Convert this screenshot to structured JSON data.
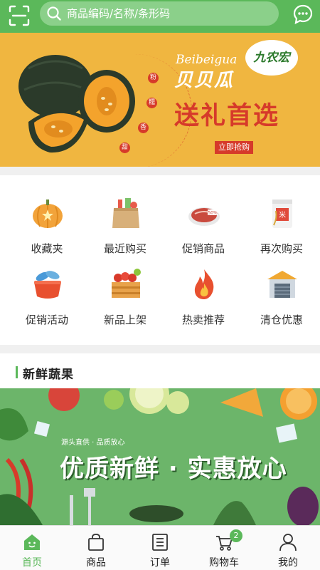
{
  "header": {
    "search_placeholder": "商品编码/名称/条形码",
    "scan_icon": "scan-icon",
    "message_icon": "message-icon"
  },
  "banner": {
    "brand_en": "Beibeigua",
    "brand_cn": "贝贝瓜",
    "title": "送礼首选",
    "button": "立即抢购",
    "logo_text": "九农宏",
    "tags": [
      "粉",
      "糯",
      "香",
      "甜"
    ]
  },
  "grid": {
    "items": [
      {
        "label": "收藏夹",
        "icon": "pumpkin-icon"
      },
      {
        "label": "最近购买",
        "icon": "grocery-bag-icon"
      },
      {
        "label": "促销商品",
        "icon": "meat-tray-icon"
      },
      {
        "label": "再次购买",
        "icon": "rice-bag-icon"
      },
      {
        "label": "促销活动",
        "icon": "fish-basket-icon"
      },
      {
        "label": "新品上架",
        "icon": "fruit-crate-icon"
      },
      {
        "label": "热卖推荐",
        "icon": "fire-icon"
      },
      {
        "label": "清仓优惠",
        "icon": "warehouse-icon"
      }
    ],
    "meat_tag": "50%",
    "rice_tag": "米"
  },
  "section": {
    "title": "新鲜蔬果"
  },
  "promo": {
    "small_text": "源头直供 · 品质放心",
    "title": "优质新鲜 · 实惠放心"
  },
  "tabbar": {
    "tabs": [
      {
        "label": "首页",
        "icon": "home-icon"
      },
      {
        "label": "商品",
        "icon": "shopping-bag-icon"
      },
      {
        "label": "订单",
        "icon": "order-list-icon"
      },
      {
        "label": "购物车",
        "icon": "cart-icon"
      },
      {
        "label": "我的",
        "icon": "user-icon"
      }
    ],
    "cart_count": "2",
    "active_color": "#5bb85a"
  },
  "colors": {
    "brand_green": "#5bb85a",
    "banner_bg": "#f0b640",
    "accent_red": "#d63a2a"
  }
}
